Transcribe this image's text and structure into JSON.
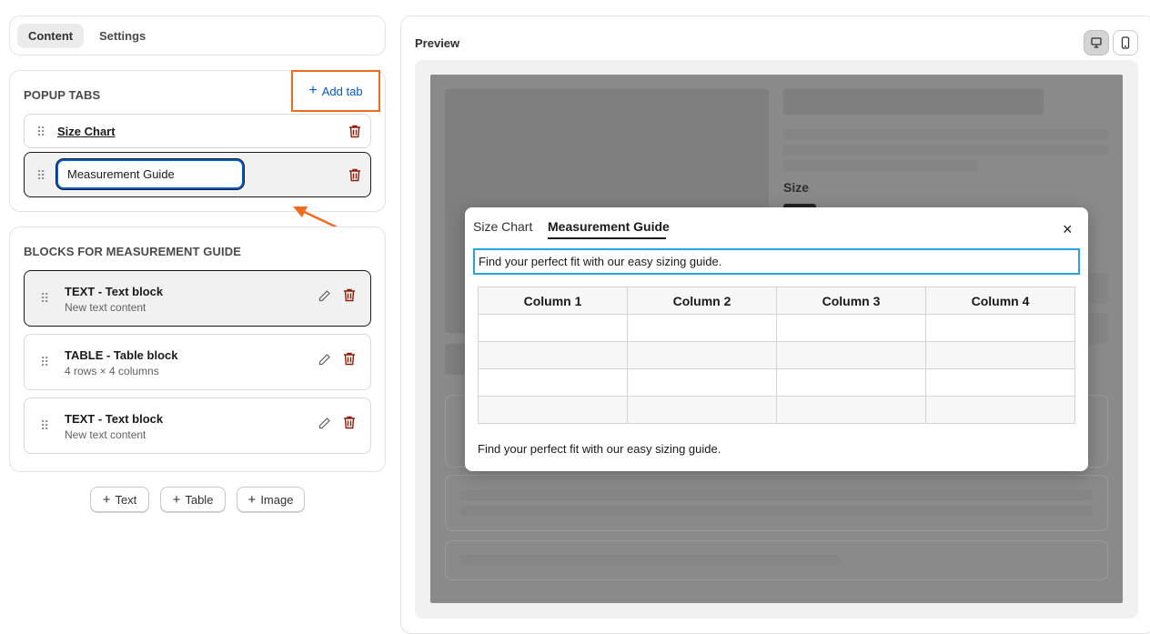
{
  "top_tabs": {
    "content": "Content",
    "settings": "Settings"
  },
  "popup_tabs": {
    "title": "POPUP TABS",
    "add_label": "Add tab",
    "items": [
      {
        "label": "Size Chart"
      },
      {
        "value": "Measurement Guide"
      }
    ]
  },
  "blocks": {
    "title": "BLOCKS FOR MEASUREMENT GUIDE",
    "items": [
      {
        "title": "TEXT - Text block",
        "subtitle": "New text content"
      },
      {
        "title": "TABLE - Table block",
        "subtitle": "4 rows × 4 columns"
      },
      {
        "title": "TEXT - Text block",
        "subtitle": "New text content"
      }
    ],
    "add_buttons": [
      "Text",
      "Table",
      "Image"
    ]
  },
  "preview": {
    "title": "Preview",
    "size_label": "Size",
    "modal": {
      "tabs": [
        "Size Chart",
        "Measurement Guide"
      ],
      "active_tab": "Measurement Guide",
      "text_top": "Find your perfect fit with our easy sizing guide.",
      "table_headers": [
        "Column 1",
        "Column 2",
        "Column 3",
        "Column 4"
      ],
      "table_rows": 4,
      "text_bottom": "Find your perfect fit with our easy sizing guide.",
      "close": "×"
    }
  },
  "colors": {
    "accent_blue": "#005bd3",
    "annotation_orange": "#f06a1f",
    "danger_red": "#8e1f0b",
    "focus_outline": "#2aa3d8"
  }
}
